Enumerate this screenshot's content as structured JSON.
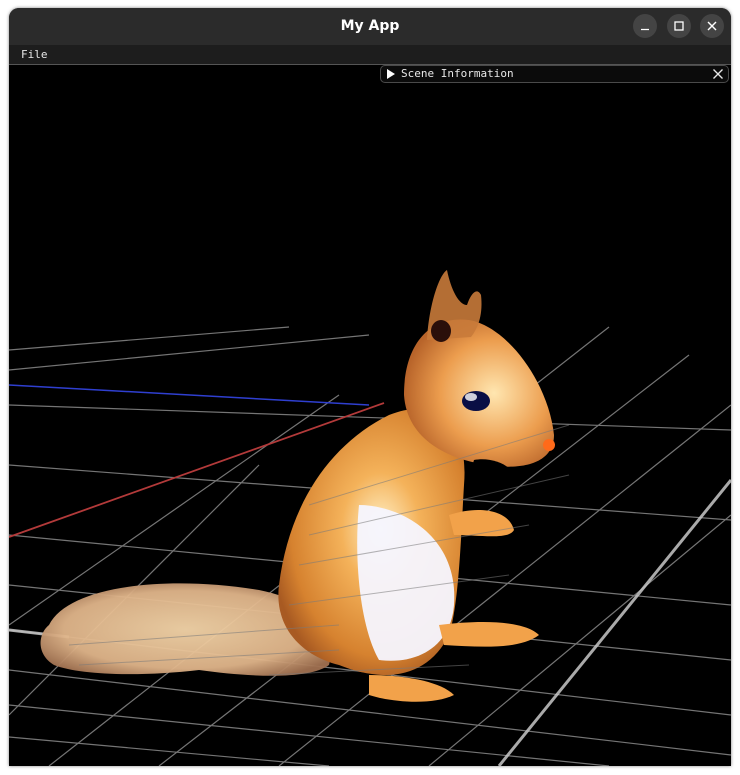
{
  "window": {
    "title": "My App",
    "controls": {
      "minimize": "minimize-icon",
      "maximize": "maximize-icon",
      "close": "close-icon"
    }
  },
  "menubar": {
    "items": [
      {
        "label": "File"
      }
    ]
  },
  "scene_panel": {
    "title": "Scene Information",
    "collapsed": true,
    "expand_icon": "triangle-right-icon",
    "close_icon": "close-icon"
  },
  "viewport": {
    "background": "#000000",
    "grid_color": "#9a9a9a",
    "axis_x_color": "#b33a3a",
    "axis_z_color": "#2f3fd0",
    "subject": "squirrel point-cloud model"
  }
}
